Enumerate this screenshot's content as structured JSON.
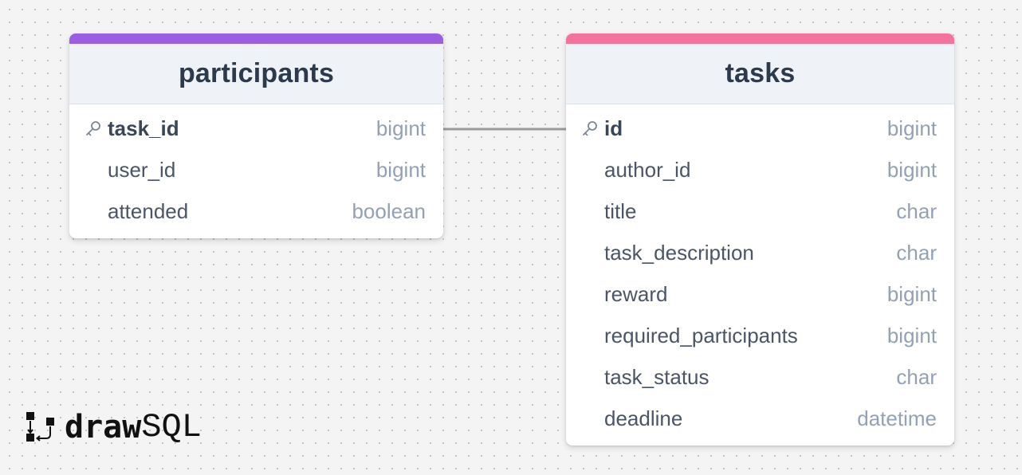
{
  "tables": {
    "participants": {
      "name": "participants",
      "accent_color": "#9a5ee0",
      "columns": [
        {
          "name": "task_id",
          "type": "bigint",
          "primary_key": true
        },
        {
          "name": "user_id",
          "type": "bigint",
          "primary_key": false
        },
        {
          "name": "attended",
          "type": "boolean",
          "primary_key": false
        }
      ]
    },
    "tasks": {
      "name": "tasks",
      "accent_color": "#f4739c",
      "columns": [
        {
          "name": "id",
          "type": "bigint",
          "primary_key": true
        },
        {
          "name": "author_id",
          "type": "bigint",
          "primary_key": false
        },
        {
          "name": "title",
          "type": "char",
          "primary_key": false
        },
        {
          "name": "task_description",
          "type": "char",
          "primary_key": false
        },
        {
          "name": "reward",
          "type": "bigint",
          "primary_key": false
        },
        {
          "name": "required_participants",
          "type": "bigint",
          "primary_key": false
        },
        {
          "name": "task_status",
          "type": "char",
          "primary_key": false
        },
        {
          "name": "deadline",
          "type": "datetime",
          "primary_key": false
        }
      ]
    }
  },
  "relations": [
    {
      "from": "participants.task_id",
      "to": "tasks.id",
      "line_color": "#9a9a9a"
    }
  ],
  "brand": {
    "bold": "draw",
    "light": "SQL",
    "icon": "drawsql-logo-icon"
  }
}
